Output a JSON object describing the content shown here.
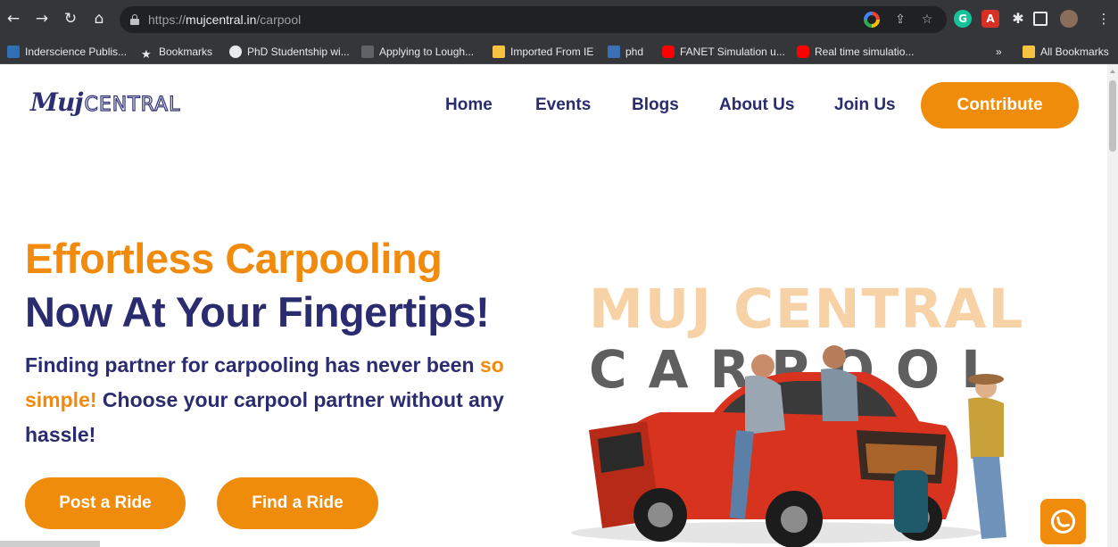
{
  "browser": {
    "url_scheme": "https://",
    "url_host": "mujcentral.in",
    "url_path": "/carpool"
  },
  "bookmarks": [
    {
      "label": "Inderscience Publis...",
      "icon": "inderscience-icon"
    },
    {
      "label": "Bookmarks",
      "icon": "star-icon"
    },
    {
      "label": "PhD Studentship wi...",
      "icon": "globe-icon"
    },
    {
      "label": "Applying to Lough...",
      "icon": "loughborough-icon"
    },
    {
      "label": "Imported From IE",
      "icon": "folder-icon"
    },
    {
      "label": "phd",
      "icon": "w3-icon"
    },
    {
      "label": "FANET Simulation u...",
      "icon": "youtube-icon"
    },
    {
      "label": "Real time simulatio...",
      "icon": "youtube-icon"
    }
  ],
  "bookmarks_overflow": "»",
  "all_bookmarks": "All Bookmarks",
  "site": {
    "logo_script": "Muj",
    "logo_word": "CENTRAL",
    "nav": [
      "Home",
      "Events",
      "Blogs",
      "About Us",
      "Join Us"
    ],
    "cta": "Contribute"
  },
  "hero": {
    "headline_1": "Effortless Carpooling",
    "headline_2": "Now At Your Fingertips!",
    "sub_1": "Finding partner for carpooling has never been",
    "sub_highlight": "so simple!",
    "sub_2": "Choose your carpool partner without any hassle!",
    "post_ride": "Post a Ride",
    "find_ride": "Find a Ride",
    "image_title_1": "MUJ CENTRAL",
    "image_title_2": "CARPOOL"
  },
  "colors": {
    "accent": "#f08c0c",
    "navy": "#2a2c6f",
    "chrome": "#35363a"
  }
}
